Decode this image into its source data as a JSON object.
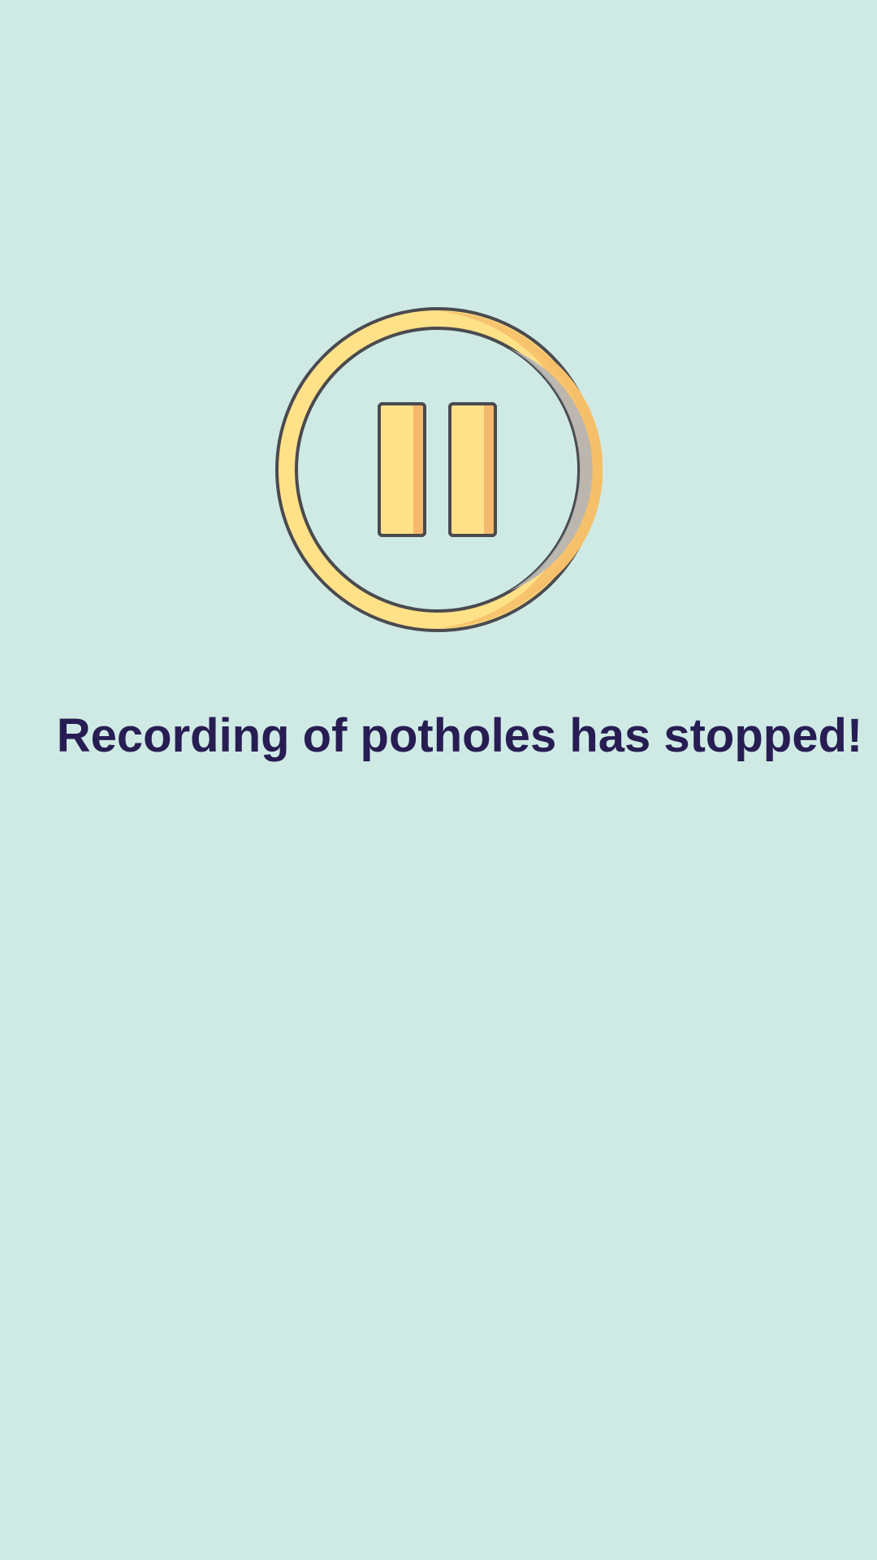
{
  "screen": {
    "status_message": "Recording of potholes has stopped!",
    "icon": "pause-icon",
    "colors": {
      "background": "#cfeae5",
      "text": "#271d52",
      "icon_fill": "#ffe188",
      "icon_outline": "#4a4a4f"
    }
  }
}
